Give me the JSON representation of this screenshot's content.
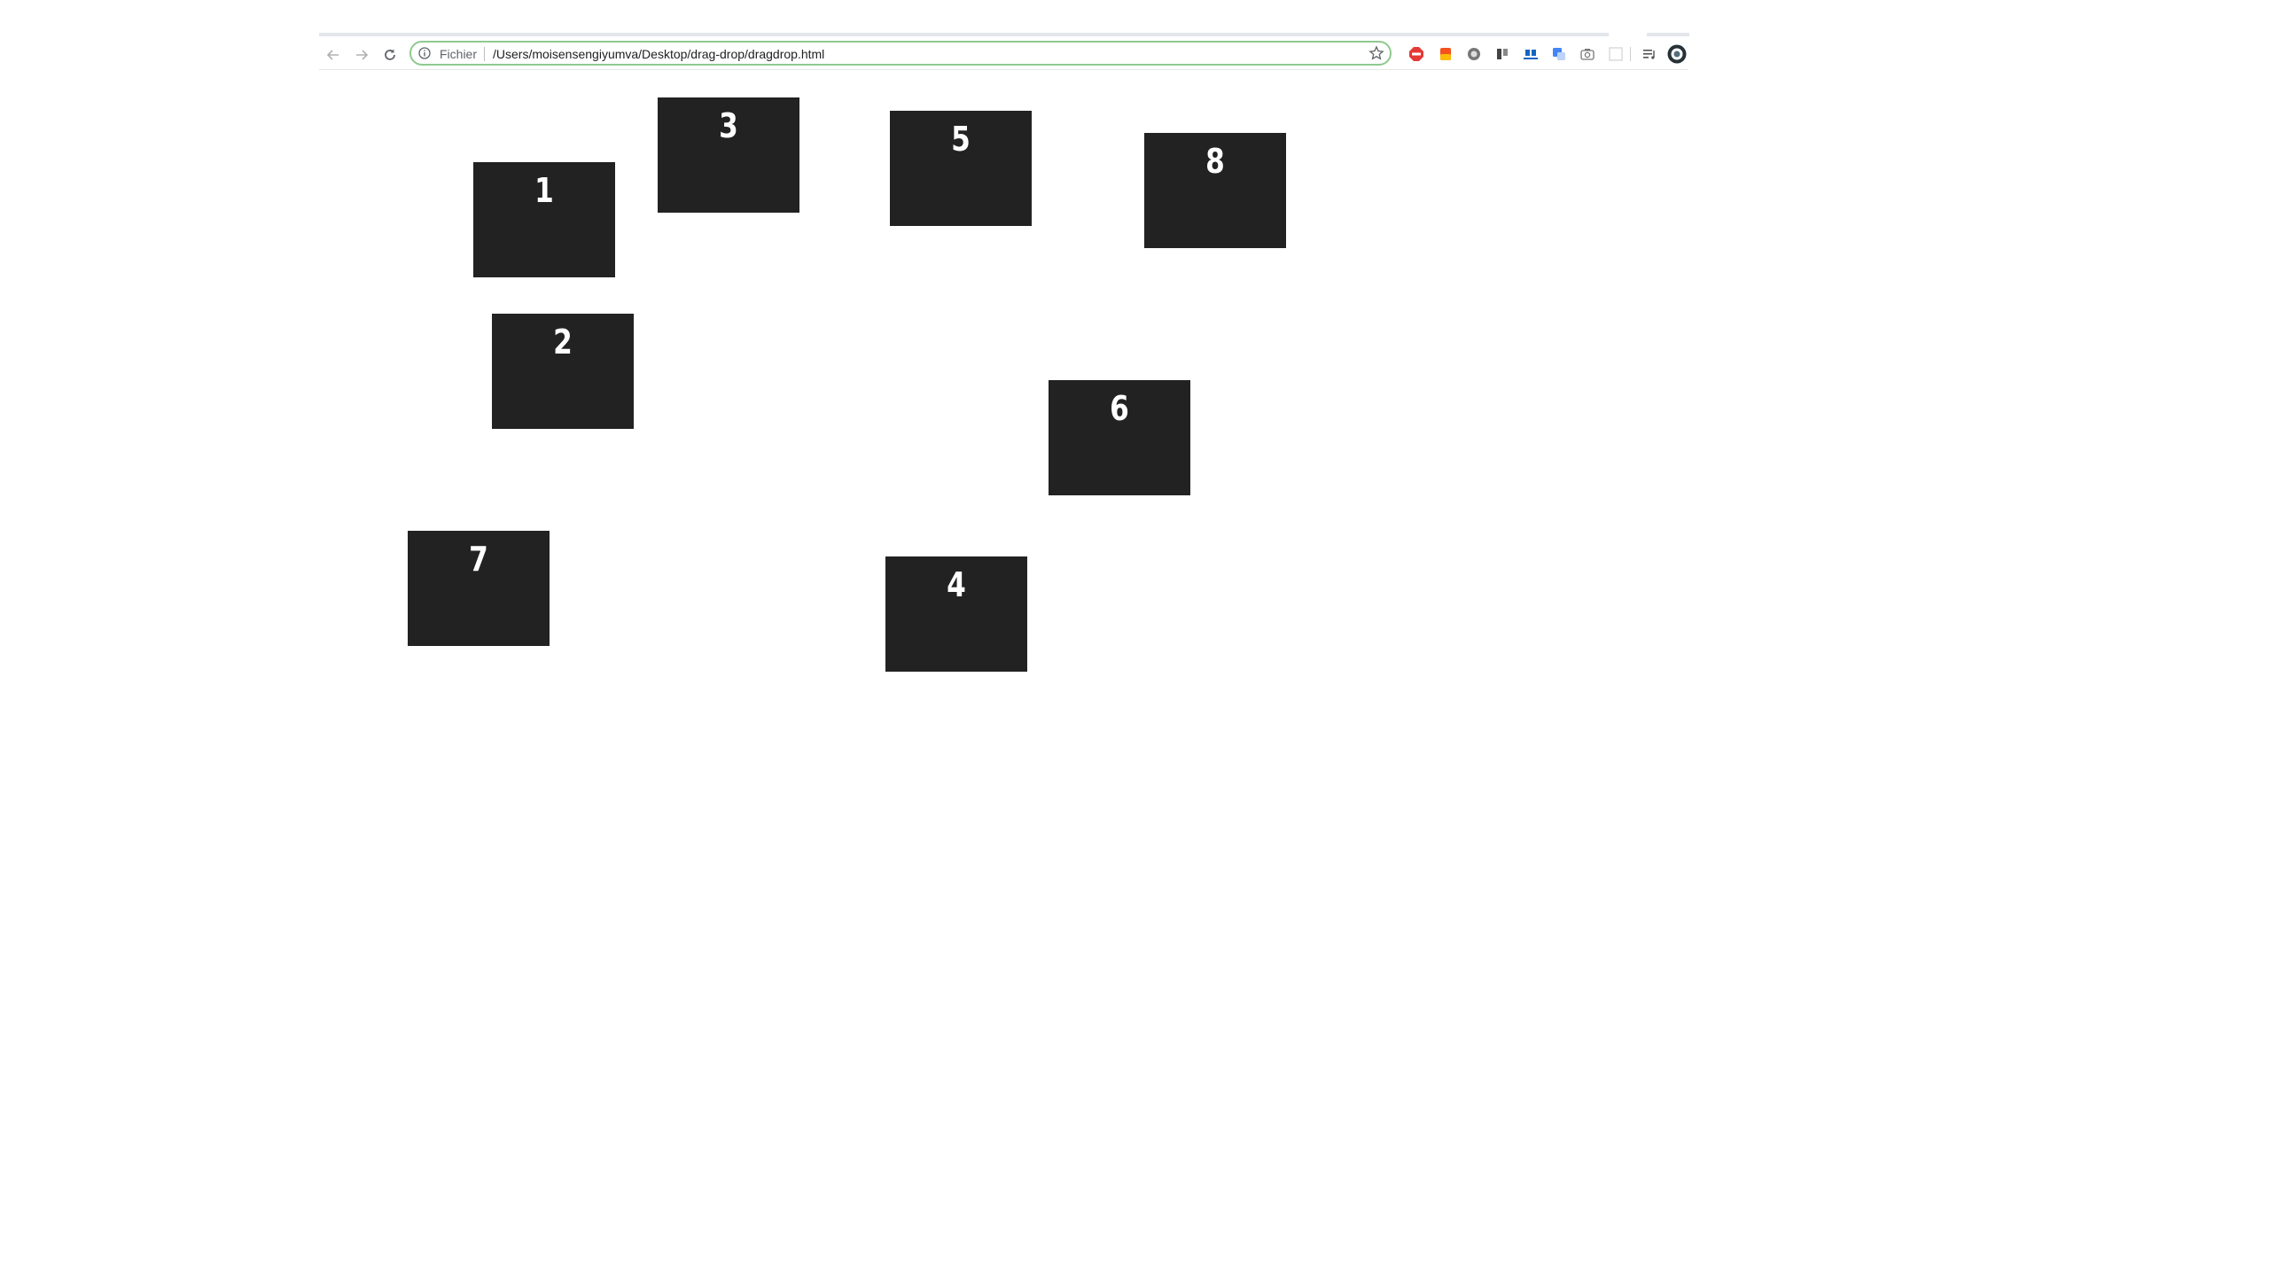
{
  "browser": {
    "scheme_label": "Fichier",
    "url": "/Users/moisensengiyumva/Desktop/drag-drop/dragdrop.html",
    "icons": {
      "back": "arrow-left-icon",
      "forward": "arrow-right-icon",
      "reload": "reload-icon",
      "info": "info-icon",
      "bookmark": "star-icon",
      "extensions": [
        "adblock-icon",
        "extension-icon",
        "extension-icon",
        "extension-icon",
        "extension-icon",
        "translate-icon",
        "camera-icon",
        "extension-icon"
      ],
      "playlist": "playlist-icon",
      "profile": "profile-avatar-icon"
    },
    "colors": {
      "omnibox_border": "#8fc98f",
      "adblock": "#e53935",
      "translate": "#4285f4"
    }
  },
  "boxes": [
    {
      "label": "1"
    },
    {
      "label": "2"
    },
    {
      "label": "3"
    },
    {
      "label": "4"
    },
    {
      "label": "5"
    },
    {
      "label": "6"
    },
    {
      "label": "7"
    },
    {
      "label": "8"
    }
  ],
  "colors": {
    "box_fill": "#222222",
    "box_text": "#ffffff",
    "page_background": "#ffffff"
  }
}
